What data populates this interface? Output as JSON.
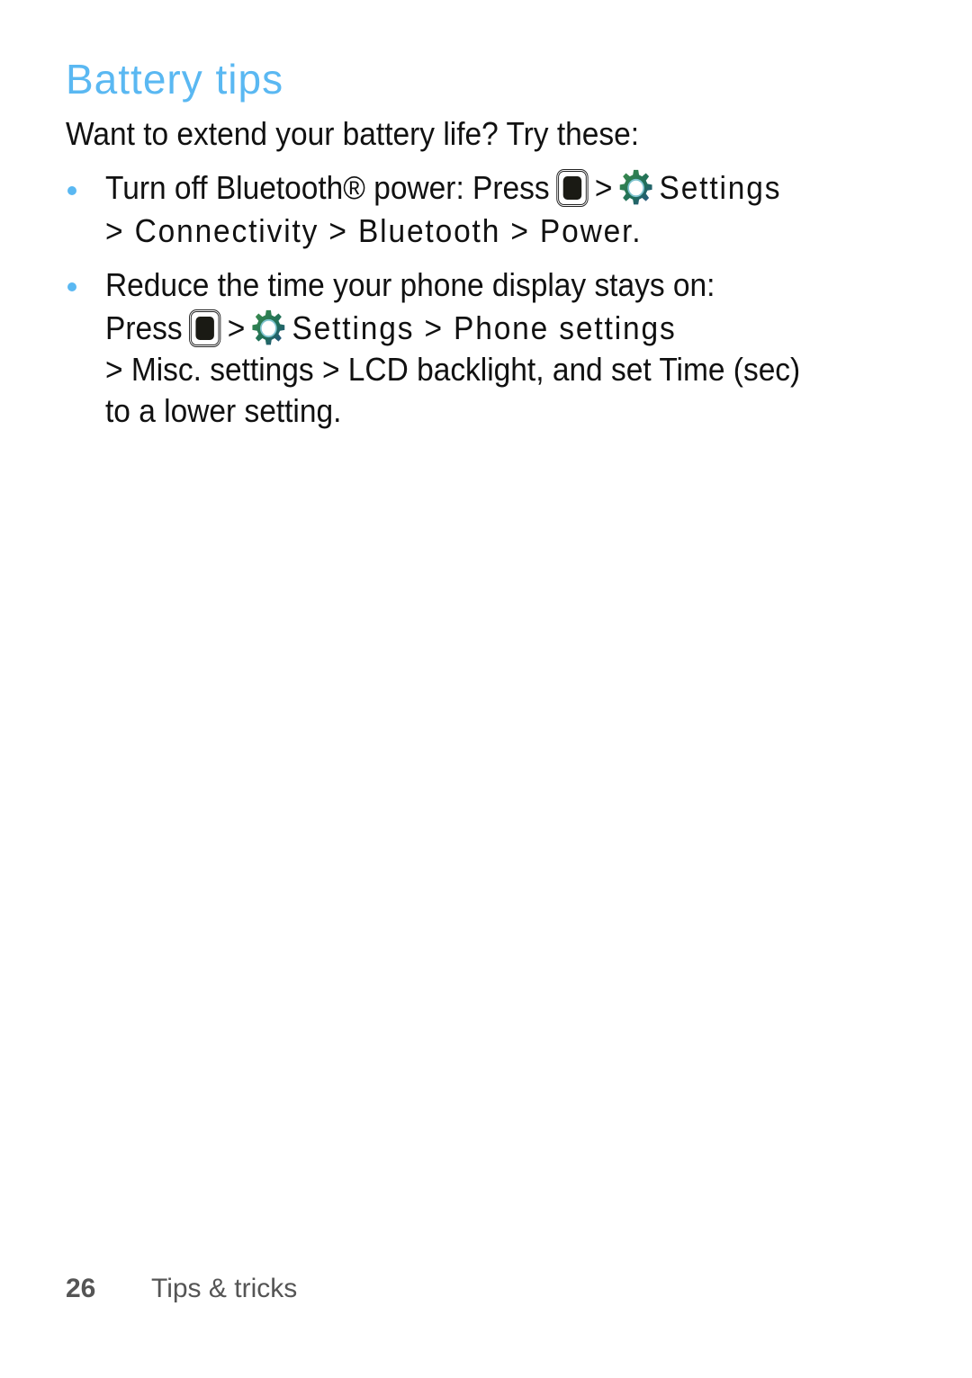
{
  "page": {
    "title": "Battery tips",
    "intro": "Want to extend your battery life? Try these:",
    "tips": [
      {
        "lead": "Turn off Bluetooth® power: Press",
        "sep": ">",
        "settings_label": "Settings",
        "path_line": "> Connectivity > Bluetooth > Power."
      },
      {
        "lead": "Reduce the time your phone display stays on:",
        "press_label": "Press",
        "sep": ">",
        "settings_label": "Settings",
        "path_segment": "> Phone settings",
        "path_line": "> Misc. settings > LCD backlight, and set Time (sec)",
        "end_line": "to a lower setting."
      }
    ],
    "icons": {
      "home": "home-key-icon",
      "settings": "settings-gear-icon",
      "bullet": "bullet-icon"
    },
    "colors": {
      "accent": "#5ab8f2",
      "text": "#111111",
      "footer": "#555555"
    }
  },
  "footer": {
    "page_number": "26",
    "section": "Tips & tricks"
  }
}
